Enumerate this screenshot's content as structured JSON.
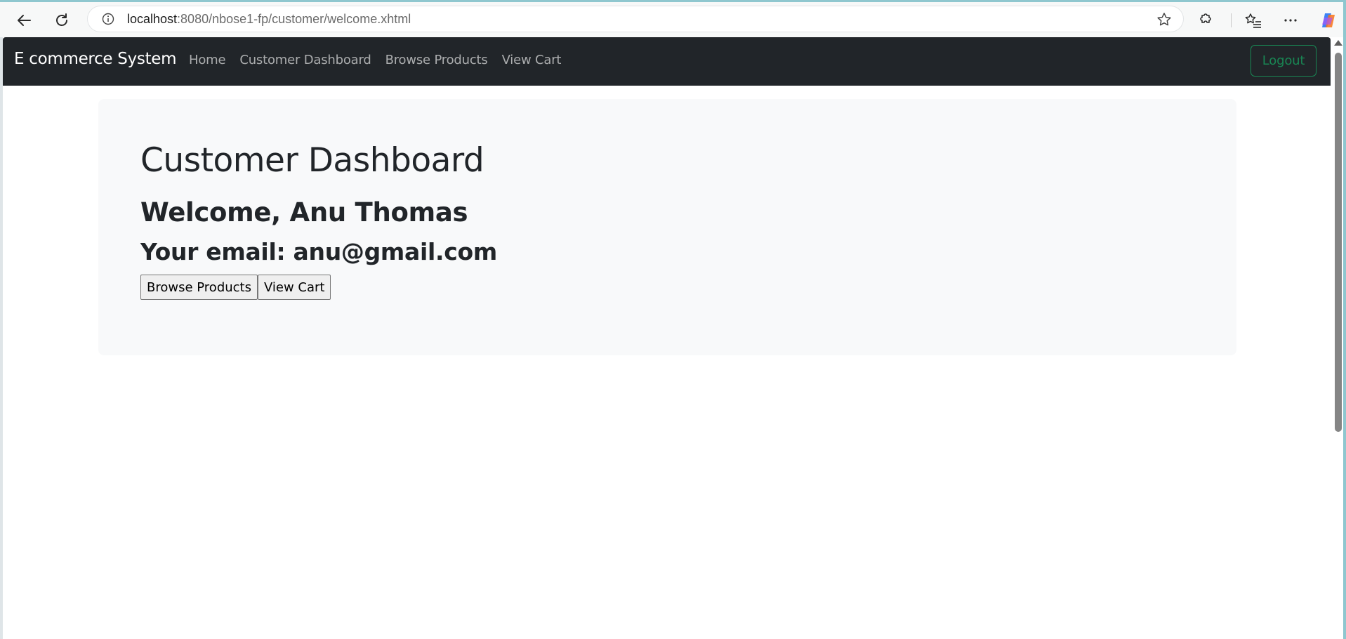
{
  "browser": {
    "url_host": "localhost",
    "url_rest": ":8080/nbose1-fp/customer/welcome.xhtml",
    "icons": [
      "back-arrow-icon",
      "refresh-icon",
      "site-info-icon",
      "favorite-star-icon",
      "extensions-icon",
      "favorites-list-icon",
      "more-menu-icon",
      "copilot-icon"
    ]
  },
  "navbar": {
    "brand": "E commerce System",
    "links": [
      {
        "label": "Home"
      },
      {
        "label": "Customer Dashboard"
      },
      {
        "label": "Browse Products"
      },
      {
        "label": "View Cart"
      }
    ],
    "logout_label": "Logout"
  },
  "main": {
    "title": "Customer Dashboard",
    "welcome": "Welcome, Anu Thomas",
    "email_line": "Your email: anu@gmail.com",
    "buttons": [
      {
        "label": "Browse Products"
      },
      {
        "label": "View Cart"
      }
    ]
  },
  "colors": {
    "navbar_bg": "#212529",
    "jumbotron_bg": "#f8f9fa",
    "logout_accent": "#198754"
  }
}
